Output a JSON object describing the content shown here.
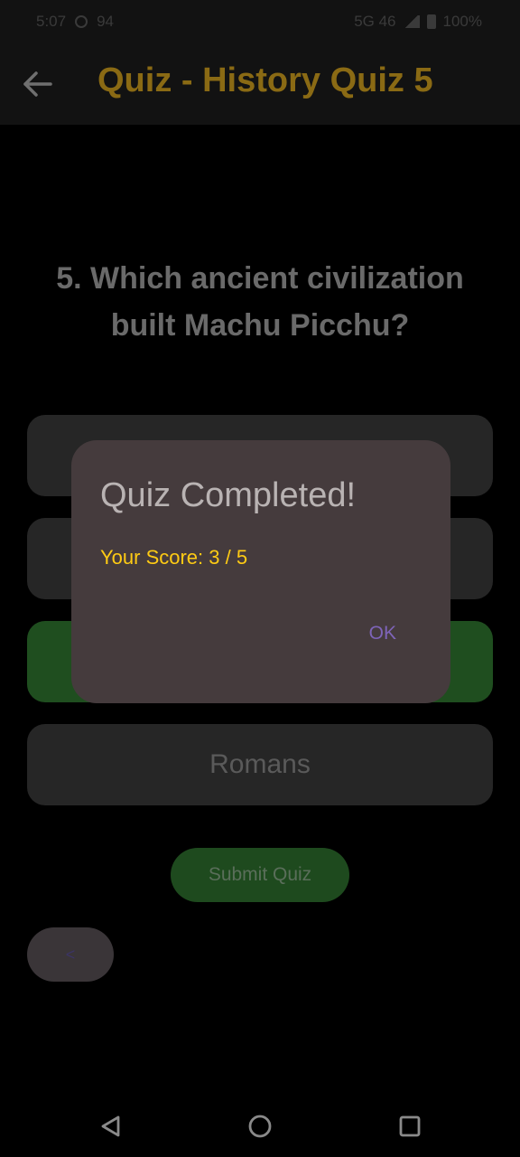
{
  "status_bar": {
    "time": "5:07",
    "extra": "94",
    "right_text": "5G 46",
    "battery": "100%"
  },
  "app_bar": {
    "title": "Quiz - History Quiz 5",
    "back_icon": "arrow-left-icon"
  },
  "question": {
    "text": "5. Which ancient civilization built Machu Picchu?"
  },
  "options": [
    {
      "label": "",
      "state": "default"
    },
    {
      "label": "",
      "state": "default"
    },
    {
      "label": "",
      "state": "correct"
    },
    {
      "label": "Romans",
      "state": "default"
    }
  ],
  "buttons": {
    "submit_label": "Submit Quiz",
    "prev_label": "<"
  },
  "dialog": {
    "title": "Quiz Completed!",
    "score_text": "Your Score: 3 / 5",
    "ok_label": "OK"
  },
  "nav_bar": {
    "icons": [
      "back-triangle-icon",
      "home-circle-icon",
      "recents-square-icon"
    ]
  },
  "colors": {
    "accent": "#ffcb14",
    "correct": "#1f4e1f",
    "dialog_bg": "#453b3d",
    "ok": "#7e64b8"
  }
}
